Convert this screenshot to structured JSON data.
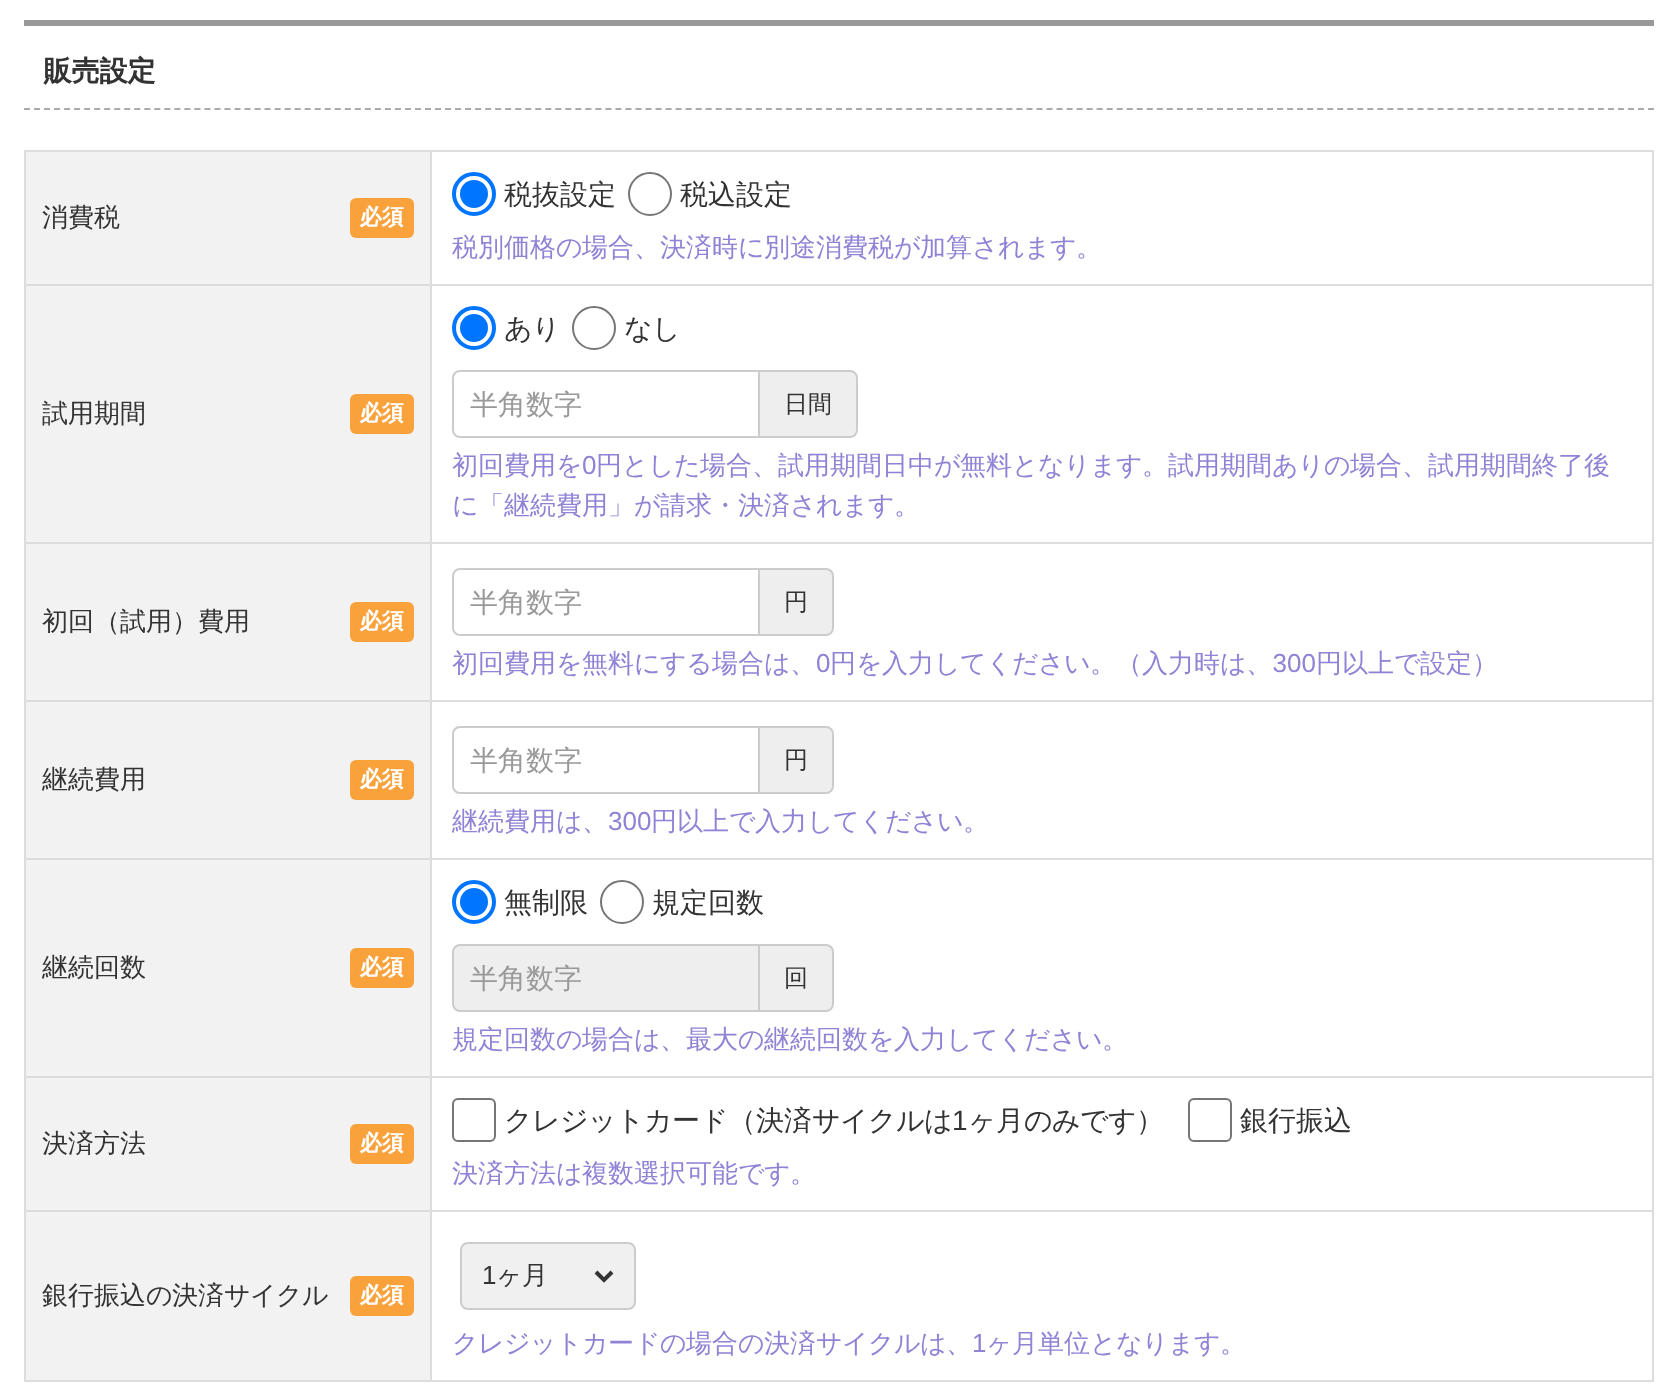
{
  "section": {
    "title": "販売設定"
  },
  "rows": [
    {
      "label": "消費税",
      "badge": "必須",
      "controls": [
        {
          "kind": "radio",
          "options": [
            {
              "label": "税抜設定",
              "selected": true
            },
            {
              "label": "税込設定",
              "selected": false
            }
          ]
        }
      ],
      "note": "税別価格の場合、決済時に別途消費税が加算されます。"
    },
    {
      "label": "試用期間",
      "badge": "必須",
      "controls": [
        {
          "kind": "radio",
          "options": [
            {
              "label": "あり",
              "selected": true
            },
            {
              "label": "なし",
              "selected": false
            }
          ]
        },
        {
          "kind": "input",
          "placeholder": "半角数字",
          "unit": "日間",
          "disabled": false
        }
      ],
      "note": "初回費用を0円とした場合、試用期間日中が無料となります。試用期間ありの場合、試用期間終了後に「継続費用」が請求・決済されます。"
    },
    {
      "label": "初回（試用）費用",
      "badge": "必須",
      "controls": [
        {
          "kind": "input",
          "placeholder": "半角数字",
          "unit": "円",
          "disabled": false
        }
      ],
      "note": "初回費用を無料にする場合は、0円を入力してください。（入力時は、300円以上で設定）"
    },
    {
      "label": "継続費用",
      "badge": "必須",
      "controls": [
        {
          "kind": "input",
          "placeholder": "半角数字",
          "unit": "円",
          "disabled": false
        }
      ],
      "note": "継続費用は、300円以上で入力してください。"
    },
    {
      "label": "継続回数",
      "badge": "必須",
      "controls": [
        {
          "kind": "radio",
          "options": [
            {
              "label": "無制限",
              "selected": true
            },
            {
              "label": "規定回数",
              "selected": false
            }
          ]
        },
        {
          "kind": "input",
          "placeholder": "半角数字",
          "unit": "回",
          "disabled": true
        }
      ],
      "note": "規定回数の場合は、最大の継続回数を入力してください。"
    },
    {
      "label": "決済方法",
      "badge": "必須",
      "controls": [
        {
          "kind": "checkbox",
          "options": [
            {
              "label": "クレジットカード（決済サイクルは1ヶ月のみです）",
              "checked": false
            },
            {
              "label": "銀行振込",
              "checked": false
            }
          ]
        }
      ],
      "note": "決済方法は複数選択可能です。"
    },
    {
      "label": "銀行振込の決済サイクル",
      "badge": "必須",
      "controls": [
        {
          "kind": "select",
          "value": "1ヶ月"
        }
      ],
      "note": "クレジットカードの場合の決済サイクルは、1ヶ月単位となります。"
    }
  ]
}
